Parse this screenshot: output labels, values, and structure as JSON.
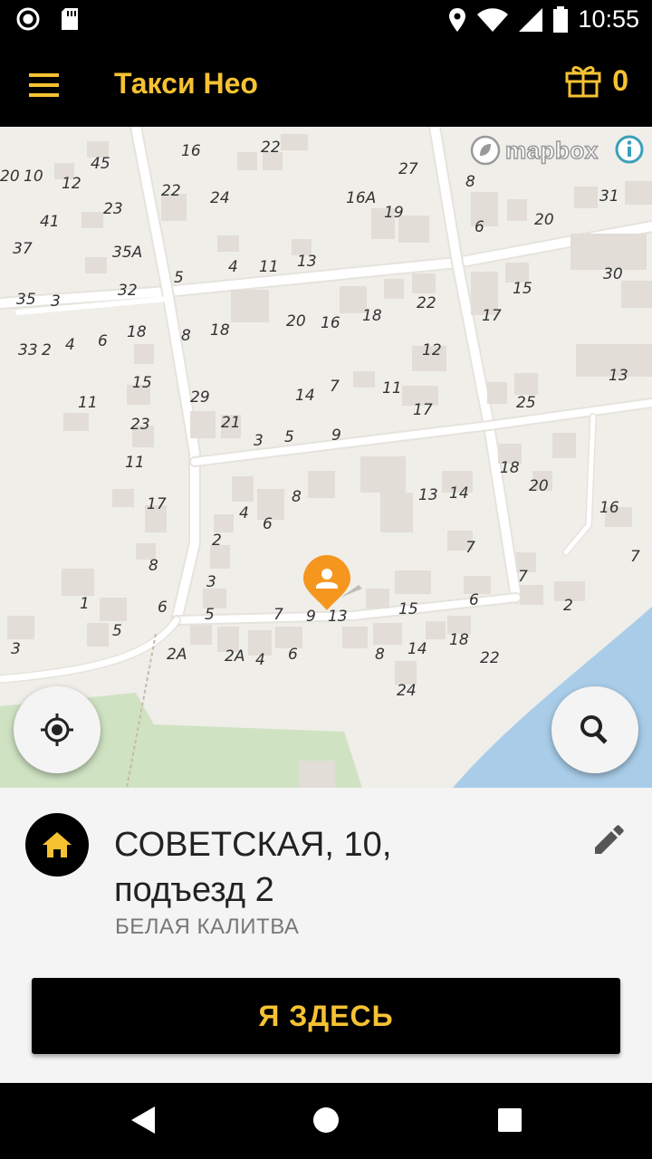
{
  "status_bar": {
    "time": "10:55",
    "icons": [
      "record-icon",
      "sd-card-icon",
      "location-icon",
      "wifi-icon",
      "signal-icon",
      "battery-icon"
    ]
  },
  "app_bar": {
    "title": "Такси Нео",
    "gift_count": "0",
    "icons": [
      "menu-icon",
      "gift-icon"
    ]
  },
  "map": {
    "attribution": "mapbox",
    "house_numbers": [
      "16",
      "22",
      "20",
      "45",
      "10",
      "12",
      "8",
      "27",
      "22",
      "24",
      "16А",
      "19",
      "23",
      "41",
      "6",
      "20",
      "31",
      "35А",
      "37",
      "4",
      "11",
      "13",
      "15",
      "30",
      "32",
      "35",
      "3",
      "5",
      "20",
      "16",
      "18",
      "22",
      "17",
      "18",
      "33",
      "2",
      "4",
      "6",
      "8",
      "18",
      "12",
      "15",
      "29",
      "14",
      "7",
      "11",
      "17",
      "11",
      "25",
      "23",
      "21",
      "3",
      "5",
      "9",
      "13",
      "11",
      "17",
      "18",
      "20",
      "13",
      "4",
      "8",
      "14",
      "16",
      "7",
      "2",
      "6",
      "7",
      "8",
      "3",
      "7",
      "1",
      "5",
      "6",
      "5",
      "7",
      "9",
      "13",
      "15",
      "6",
      "2",
      "3",
      "2А",
      "2А",
      "4",
      "6",
      "8",
      "14",
      "18",
      "22",
      "24",
      "16"
    ],
    "colors": {
      "land": "#f0eee9",
      "road": "#ffffff",
      "building": "#e2ddd6",
      "water": "#a9cde9",
      "park": "#cfe3c3",
      "pin": "#f5961f"
    }
  },
  "buttons": {
    "locate_icon": "crosshair-icon",
    "search_icon": "search-icon"
  },
  "address": {
    "street": "СОВЕТСКАЯ, 10, подъезд 2",
    "city": "БЕЛАЯ КАЛИТВА"
  },
  "actions": {
    "here_label": "Я ЗДЕСЬ"
  }
}
